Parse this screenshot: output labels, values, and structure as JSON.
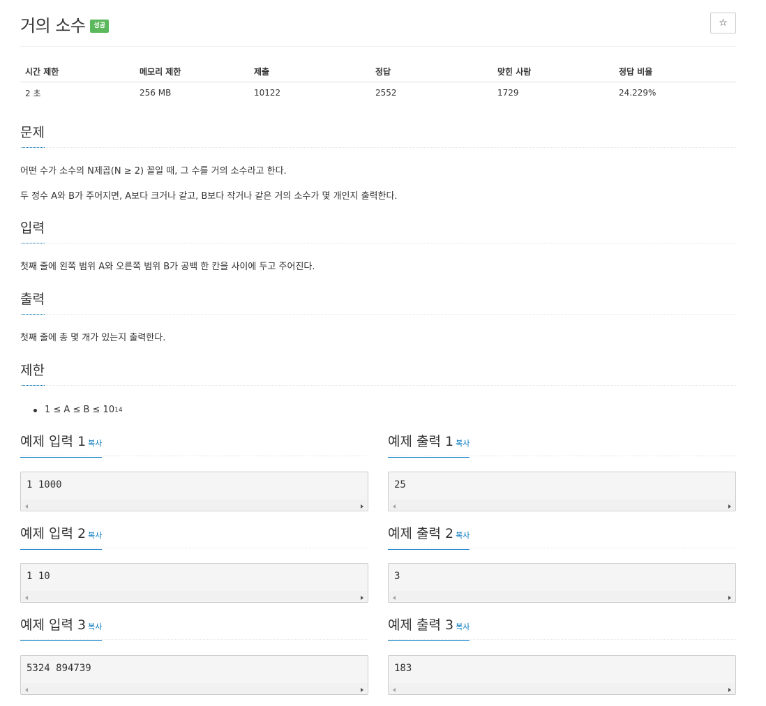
{
  "problem": {
    "title": "거의 소수",
    "badge": "성공",
    "star_label": "☆"
  },
  "stats": {
    "headers": [
      "시간 제한",
      "메모리 제한",
      "제출",
      "정답",
      "맞힌 사람",
      "정답 비율"
    ],
    "values": [
      "2 초",
      "256 MB",
      "10122",
      "2552",
      "1729",
      "24.229%"
    ]
  },
  "sections": {
    "problem": {
      "heading": "문제",
      "lines": [
        "어떤 수가 소수의 N제곱(N ≥ 2) 꼴일 때, 그 수를 거의 소수라고 한다.",
        "두 정수 A와 B가 주어지면, A보다 크거나 같고, B보다 작거나 같은 거의 소수가 몇 개인지 출력한다."
      ]
    },
    "input": {
      "heading": "입력",
      "text": "첫째 줄에 왼쪽 범위 A와 오른쪽 범위 B가 공백 한 칸을 사이에 두고 주어진다."
    },
    "output": {
      "heading": "출력",
      "text": "첫째 줄에 총 몇 개가 있는지 출력한다."
    },
    "limit": {
      "heading": "제한",
      "item_base": "1 ≤ A ≤ B ≤ 10",
      "item_exp": "14"
    }
  },
  "copy_label": "복사",
  "samples": [
    {
      "input_title": "예제 입력 1",
      "output_title": "예제 출력 1",
      "input": "1 1000",
      "output": "25"
    },
    {
      "input_title": "예제 입력 2",
      "output_title": "예제 출력 2",
      "input": "1 10",
      "output": "3"
    },
    {
      "input_title": "예제 입력 3",
      "output_title": "예제 출력 3",
      "input": "5324 894739",
      "output": "183"
    }
  ],
  "colors": {
    "accent": "#0076c0",
    "badge_success": "#5cb85c",
    "pre_background": "#f5f5f5"
  }
}
